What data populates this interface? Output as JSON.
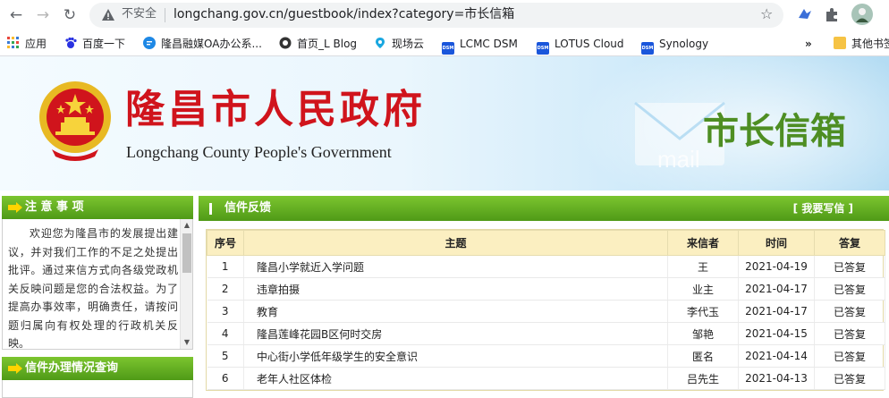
{
  "browser": {
    "insecure_label": "不安全",
    "url": "longchang.gov.cn/guestbook/index?category=市长信箱",
    "bookmarks": [
      {
        "label": "应用",
        "icon": "apps-icon"
      },
      {
        "label": "百度一下",
        "icon": "baidu-icon"
      },
      {
        "label": "隆昌融媒OA办公系...",
        "icon": "chat-icon"
      },
      {
        "label": "首页_L Blog",
        "icon": "blog-icon"
      },
      {
        "label": "现场云",
        "icon": "cloud-icon"
      },
      {
        "label": "LCMC DSM",
        "icon": "dsm-icon"
      },
      {
        "label": "LOTUS Cloud",
        "icon": "dsm-icon"
      },
      {
        "label": "Synology",
        "icon": "dsm-icon"
      }
    ],
    "more_label": "»",
    "other_bookmarks": "其他书签"
  },
  "banner": {
    "title_cn": "隆昌市人民政府",
    "title_en": "Longchang County People's Government",
    "section": "市长信箱",
    "mail_word": "mail"
  },
  "left": {
    "notice_title": "注 意 事 项",
    "notice_text": "欢迎您为隆昌市的发展提出建议，并对我们工作的不足之处提出批评。通过来信方式向各级党政机关反映问题是您的合法权益。为了提高办事效率，明确责任，请按问题归属向有权处理的行政机关反映。",
    "query_title": "信件办理情况查询"
  },
  "right": {
    "title": "信件反馈",
    "write_link": "[ 我要写信 ]",
    "columns": [
      "序号",
      "主题",
      "来信者",
      "时间",
      "答复"
    ],
    "rows": [
      {
        "no": "1",
        "subject": "隆昌小学就近入学问题",
        "sender": "王",
        "date": "2021-04-19",
        "reply": "已答复"
      },
      {
        "no": "2",
        "subject": "违章拍摄",
        "sender": "业主",
        "date": "2021-04-17",
        "reply": "已答复"
      },
      {
        "no": "3",
        "subject": "教育",
        "sender": "李代玉",
        "date": "2021-04-17",
        "reply": "已答复"
      },
      {
        "no": "4",
        "subject": "隆昌莲峰花园B区何时交房",
        "sender": "邹艳",
        "date": "2021-04-15",
        "reply": "已答复"
      },
      {
        "no": "5",
        "subject": "中心街小学低年级学生的安全意识",
        "sender": "匿名",
        "date": "2021-04-14",
        "reply": "已答复"
      },
      {
        "no": "6",
        "subject": "老年人社区体检",
        "sender": "吕先生",
        "date": "2021-04-13",
        "reply": "已答复"
      }
    ]
  }
}
